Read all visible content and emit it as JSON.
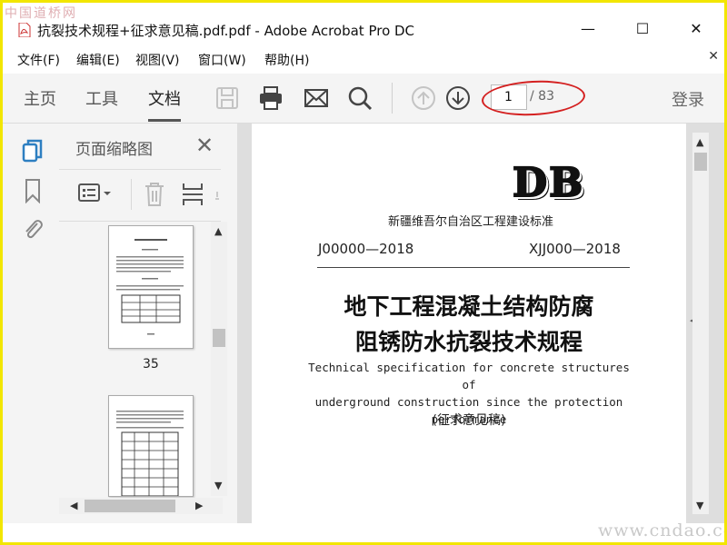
{
  "watermark": {
    "top": "中国道桥网",
    "bottom": "www.cndao.com"
  },
  "window": {
    "title": "抗裂技术规程+征求意见稿.pdf.pdf - Adobe Acrobat Pro DC",
    "minimize": "—",
    "maximize": "☐",
    "close": "✕"
  },
  "menu": {
    "items": [
      "文件(F)",
      "编辑(E)",
      "视图(V)",
      "窗口(W)",
      "帮助(H)"
    ],
    "close": "✕"
  },
  "toolbar": {
    "tabs": [
      "主页",
      "工具",
      "文档"
    ],
    "active_tab": "文档",
    "icons": [
      "save-icon",
      "print-icon",
      "email-icon",
      "search-icon",
      "page-up-icon",
      "page-down-icon"
    ],
    "page_current": "1",
    "page_total": "/ 83",
    "login": "登录"
  },
  "navstrip": {
    "icons": [
      "page-thumbnails-icon",
      "bookmark-icon",
      "attachment-icon"
    ]
  },
  "thumbnails": {
    "title": "页面缩略图",
    "close": "✕",
    "pages": [
      {
        "label": "35"
      },
      {
        "label": ""
      }
    ]
  },
  "document": {
    "logo": "DB",
    "standard": "新疆维吾尔自治区工程建设标准",
    "code_left": "J00000—2018",
    "code_right": "XJJ000—2018",
    "title_line1": "地下工程混凝土结构防腐",
    "title_line2": "阻锈防水抗裂技术规程",
    "title_en_1": "Technical specification for concrete structures of",
    "title_en_2": "underground construction since the protection",
    "title_en_3": "performance",
    "draft": "(征求意见稿)"
  },
  "colors": {
    "accent": "#2d7fc1",
    "annotation": "#d42020",
    "frame": "#f2e600"
  }
}
